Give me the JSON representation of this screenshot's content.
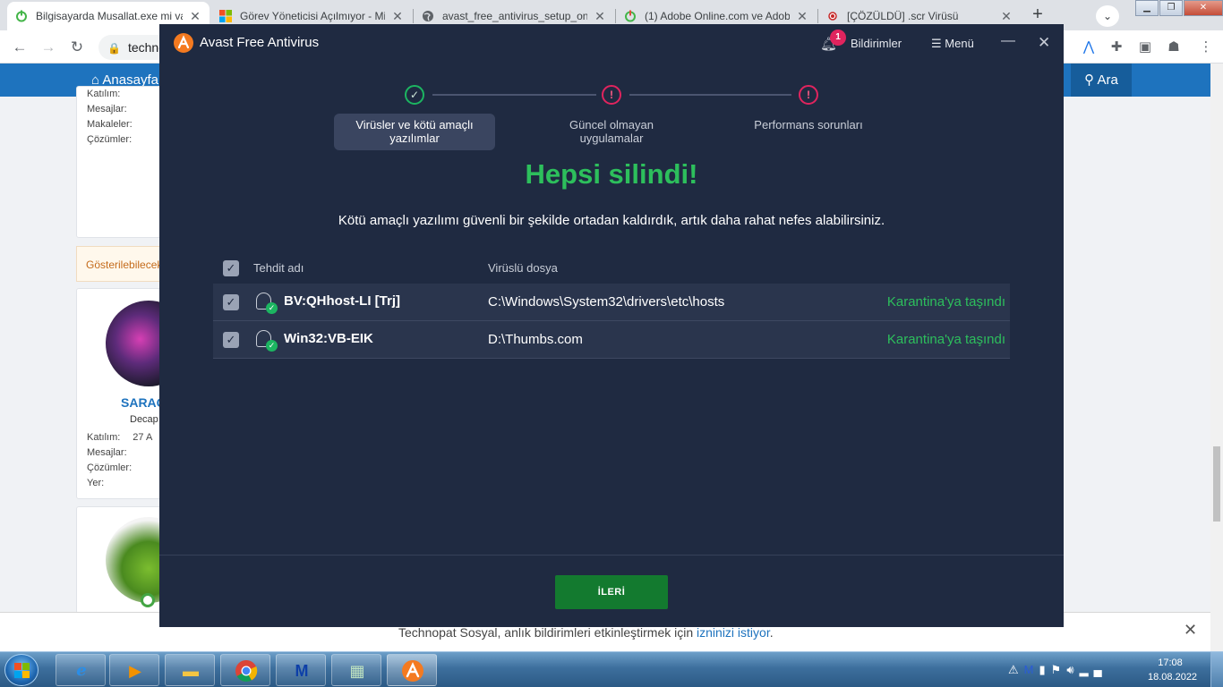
{
  "browser": {
    "tabs": [
      {
        "label": "Bilgisayarda Musallat.exe mi va",
        "active": true,
        "icon": "power-icon"
      },
      {
        "label": "Görev Yöneticisi Açılmıyor - Mi",
        "active": false,
        "icon": "windows-icon"
      },
      {
        "label": "avast_free_antivirus_setup_onli",
        "active": false,
        "icon": "globe-icon"
      },
      {
        "label": "(1) Adobe Online.com ve Adob",
        "active": false,
        "icon": "power-icon"
      },
      {
        "label": "[ÇÖZÜLDÜ] .scr Virüsü",
        "active": false,
        "icon": "record-icon"
      }
    ],
    "close_glyph": "✕",
    "new_tab_glyph": "+",
    "omnibox_text": "techno"
  },
  "site": {
    "home_label": "Anasayfa",
    "search_label": "Ara",
    "notice_text": "Gösterilebilecek",
    "user1_labels": [
      "Katılım:",
      "Mesajlar:",
      "Makaleler:",
      "Çözümler:"
    ],
    "user2_name": "SARAG",
    "user2_role": "Decap",
    "user2_labels": [
      "Katılım:",
      "Mesajlar:",
      "Çözümler:",
      "Yer:"
    ],
    "user2_join_value": "27 A",
    "push_text": "Technopat Sosyal, anlık bildirimleri etkinleştirmek için ",
    "push_link": "izninizi istiyor",
    "push_tail": ".",
    "push_close": "✕"
  },
  "avast": {
    "title": "Avast Free Antivirus",
    "notif_count": "1",
    "notif_label": "Bildirimler",
    "menu_label": "Menü",
    "minimize_glyph": "—",
    "close_glyph": "✕",
    "steps": [
      {
        "label": "Virüsler ve kötü amaçlı yazılımlar",
        "status": "done",
        "glyph": "✓",
        "active": true
      },
      {
        "label": "Güncel olmayan uygulamalar",
        "status": "warning",
        "glyph": "!",
        "active": false
      },
      {
        "label": "Performans sorunları",
        "status": "warning",
        "glyph": "!",
        "active": false
      }
    ],
    "headline": "Hepsi silindi!",
    "subtext": "Kötü amaçlı yazılımı güvenli bir şekilde ortadan kaldırdık, artık daha rahat nefes alabilirsiniz.",
    "table": {
      "col_threat": "Tehdit adı",
      "col_file": "Virüslü dosya",
      "rows": [
        {
          "name": "BV:QHhost-LI [Trj]",
          "file": "C:\\Windows\\System32\\drivers\\etc\\hosts",
          "status": "Karantina'ya taşındı",
          "checked": true
        },
        {
          "name": "Win32:VB-EIK",
          "file": "D:\\Thumbs.com",
          "status": "Karantina'ya taşındı",
          "checked": true
        }
      ]
    },
    "next_label": "İLERİ",
    "colors": {
      "bg": "#1f2a41",
      "success": "#2dbf5c",
      "warning": "#e0245e",
      "button": "#137a2f"
    }
  },
  "taskbar": {
    "apps": [
      "internet-explorer-icon",
      "media-player-icon",
      "explorer-folder-icon",
      "chrome-icon",
      "malwarebytes-icon",
      "pixel-app-icon",
      "avast-icon"
    ],
    "time": "17:08",
    "date": "18.08.2022"
  }
}
